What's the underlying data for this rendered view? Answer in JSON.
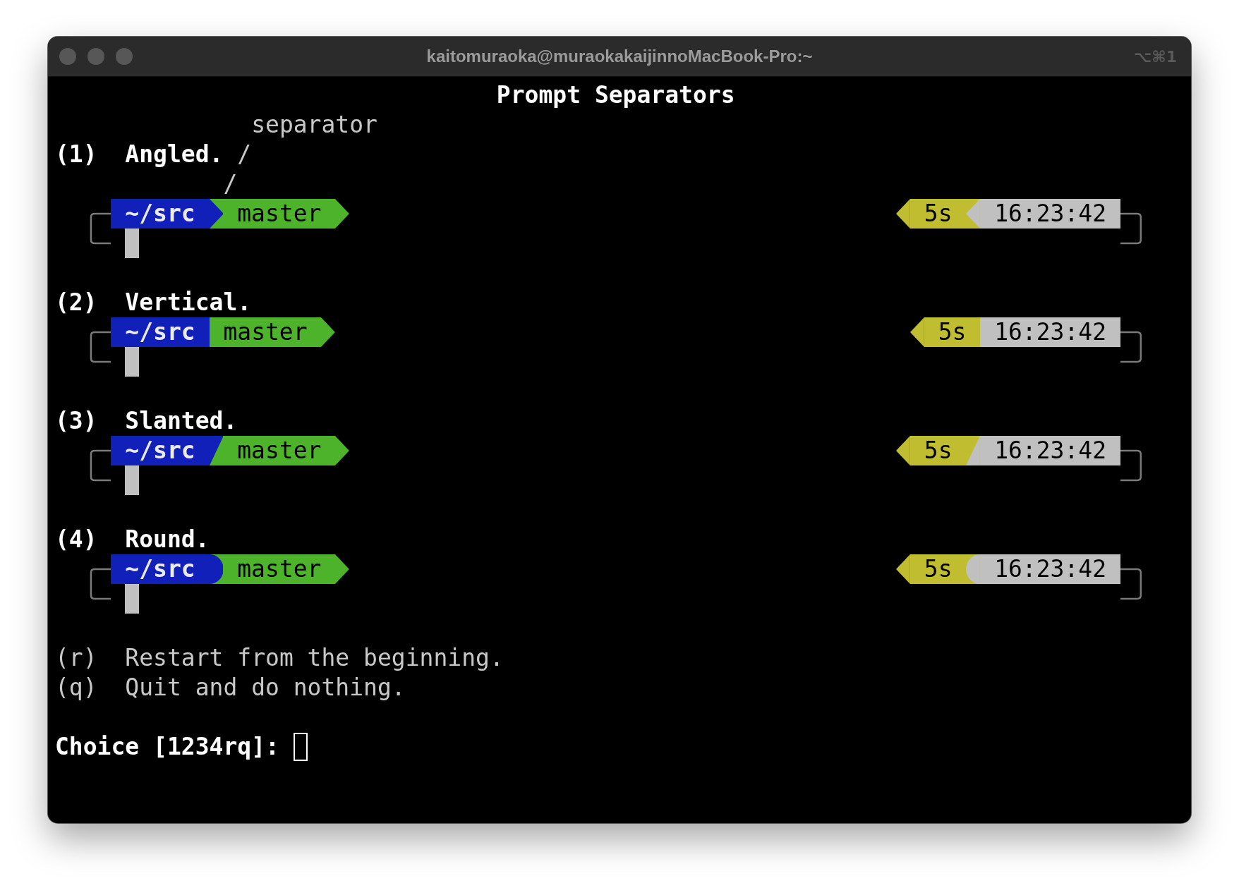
{
  "window": {
    "title": "kaitomuraoka@muraokakaijinnoMacBook-Pro:~",
    "shortcut": "⌥⌘1"
  },
  "heading": "Prompt Separators",
  "options": [
    {
      "key": "(1)",
      "label": "Angled.",
      "kind": "angled",
      "annotation": {
        "label": "separator",
        "pointer_top": "/",
        "pointer_bottom": "/"
      },
      "left_segments": [
        {
          "text": "~/src",
          "color": "#1020b8"
        },
        {
          "text": "master",
          "color": "#4db32a"
        }
      ],
      "right_segments": [
        {
          "text": "5s",
          "color": "#c0bd30"
        },
        {
          "text": "16:23:42",
          "color": "#c0c0c0"
        }
      ]
    },
    {
      "key": "(2)",
      "label": "Vertical.",
      "kind": "vertical",
      "left_segments": [
        {
          "text": "~/src",
          "color": "#1020b8"
        },
        {
          "text": "master",
          "color": "#4db32a"
        }
      ],
      "right_segments": [
        {
          "text": "5s",
          "color": "#c0bd30"
        },
        {
          "text": "16:23:42",
          "color": "#c0c0c0"
        }
      ]
    },
    {
      "key": "(3)",
      "label": "Slanted.",
      "kind": "slanted",
      "left_segments": [
        {
          "text": "~/src",
          "color": "#1020b8"
        },
        {
          "text": "master",
          "color": "#4db32a"
        }
      ],
      "right_segments": [
        {
          "text": "5s",
          "color": "#c0bd30"
        },
        {
          "text": "16:23:42",
          "color": "#c0c0c0"
        }
      ]
    },
    {
      "key": "(4)",
      "label": "Round.",
      "kind": "round",
      "left_segments": [
        {
          "text": "~/src",
          "color": "#1020b8"
        },
        {
          "text": "master",
          "color": "#4db32a"
        }
      ],
      "right_segments": [
        {
          "text": "5s",
          "color": "#c0bd30"
        },
        {
          "text": "16:23:42",
          "color": "#c0c0c0"
        }
      ]
    }
  ],
  "commands": [
    {
      "key": "(r)",
      "label": "Restart from the beginning."
    },
    {
      "key": "(q)",
      "label": "Quit and do nothing."
    }
  ],
  "prompt": {
    "label": "Choice [1234rq]:"
  }
}
